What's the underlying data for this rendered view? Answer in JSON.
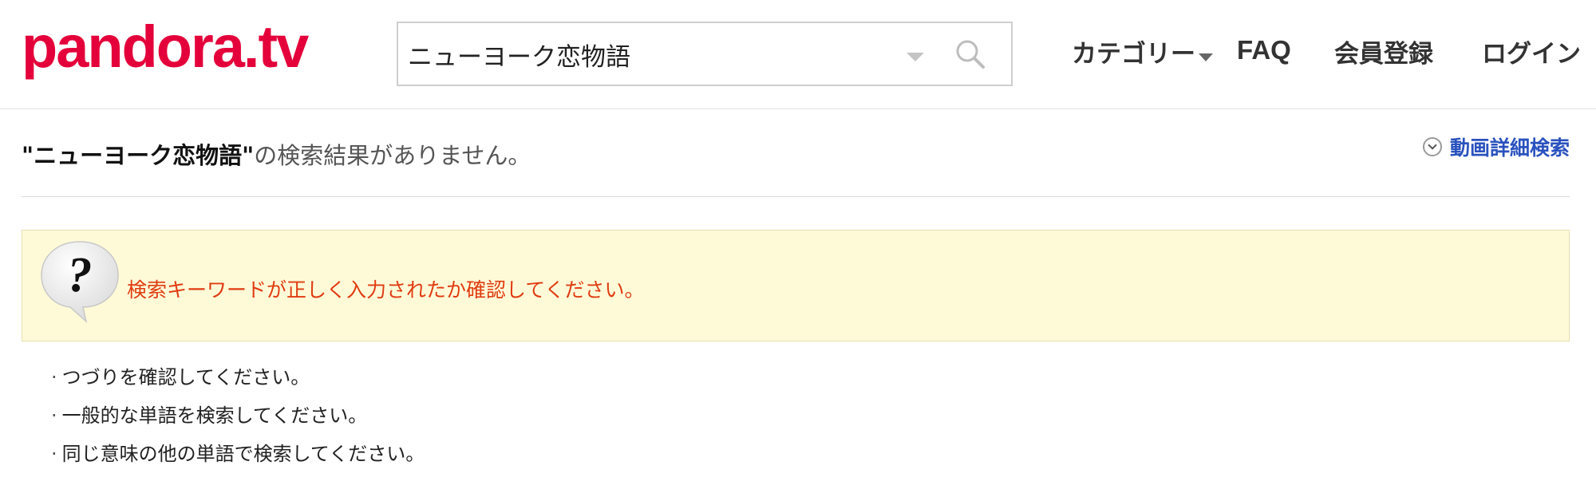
{
  "header": {
    "logo": "pandora.tv",
    "search": {
      "value": "ニューヨーク恋物語"
    },
    "nav": {
      "category": "カテゴリー",
      "faq": "FAQ",
      "register": "会員登録",
      "login": "ログイン"
    }
  },
  "result": {
    "query_quoted": "\"ニューヨーク恋物語\"",
    "suffix": "の検索結果がありません。",
    "detail_search": "動画詳細検索"
  },
  "notice": {
    "icon_text": "?",
    "message": "検索キーワードが正しく入力されたか確認してください。"
  },
  "tips": {
    "bullet": "·",
    "items": [
      "つづりを確認してください。",
      "一般的な単語を検索してください。",
      "同じ意味の他の単語で検索してください。"
    ]
  },
  "colors": {
    "brand": "#e4003a",
    "link": "#2a52be",
    "notice_bg": "#fefad8",
    "notice_text": "#e03c10"
  },
  "icons": {
    "search": "search-icon",
    "dropdown": "chevron-down-icon",
    "detail": "circle-chevron-down-icon",
    "help": "question-bubble-icon"
  }
}
